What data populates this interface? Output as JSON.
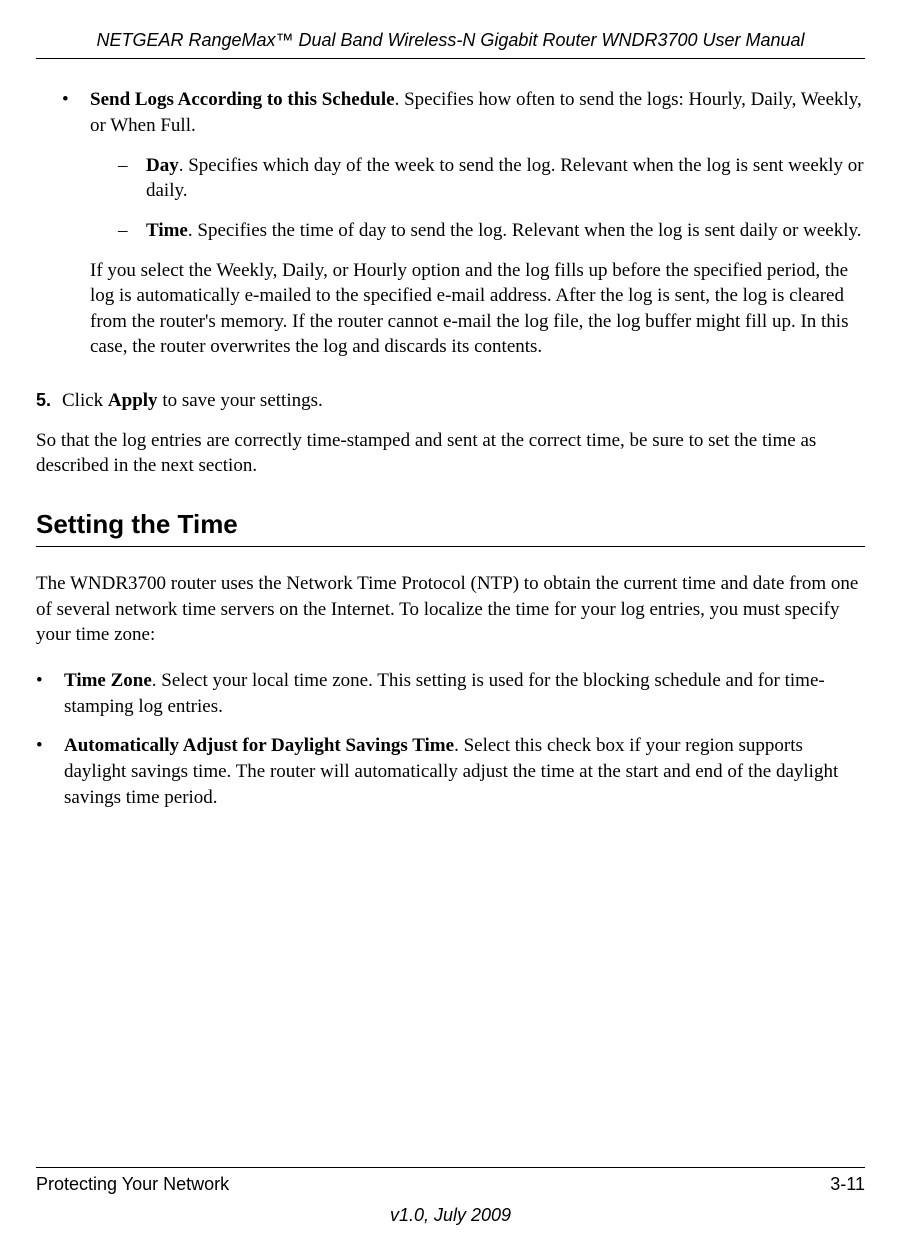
{
  "header": {
    "title": "NETGEAR RangeMax™ Dual Band Wireless-N Gigabit Router WNDR3700 User Manual"
  },
  "content": {
    "bullet1_bold": "Send Logs According to this Schedule",
    "bullet1_rest": ". Specifies how often to send the logs: Hourly, Daily, Weekly, or When Full.",
    "sub1_bold": "Day",
    "sub1_rest": ". Specifies which day of the week to send the log. Relevant when the log is sent weekly or daily.",
    "sub2_bold": "Time",
    "sub2_rest": ". Specifies the time of day to send the log. Relevant when the log is sent daily or weekly.",
    "para_fill": "If you select the Weekly, Daily, or Hourly option and the log fills up before the specified period, the log is automatically e-mailed to the specified e-mail address. After the log is sent, the log is cleared from the router's memory. If the router cannot e-mail the log file, the log buffer might fill up. In this case, the router overwrites the log and discards its contents.",
    "step5_num": "5.",
    "step5_pre": "Click ",
    "step5_bold": "Apply",
    "step5_post": " to save your settings.",
    "para_timestamp": "So that the log entries are correctly time-stamped and sent at the correct time, be sure to set the time as described in the next section.",
    "section_heading": "Setting the Time",
    "para_ntp": "The WNDR3700 router uses the Network Time Protocol (NTP) to obtain the current time and date from one of several network time servers on the Internet. To localize the time for your log entries, you must specify your time zone:",
    "tz_bold": "Time Zone",
    "tz_rest": ". Select your local time zone. This setting is used for the blocking schedule and for time-stamping log entries.",
    "dst_bold": "Automatically Adjust for Daylight Savings Time",
    "dst_rest": ". Select this check box if your region supports daylight savings time. The router will automatically adjust the time at the start and end of the daylight savings time period."
  },
  "footer": {
    "chapter": "Protecting Your Network",
    "page": "3-11",
    "version": "v1.0, July 2009"
  }
}
